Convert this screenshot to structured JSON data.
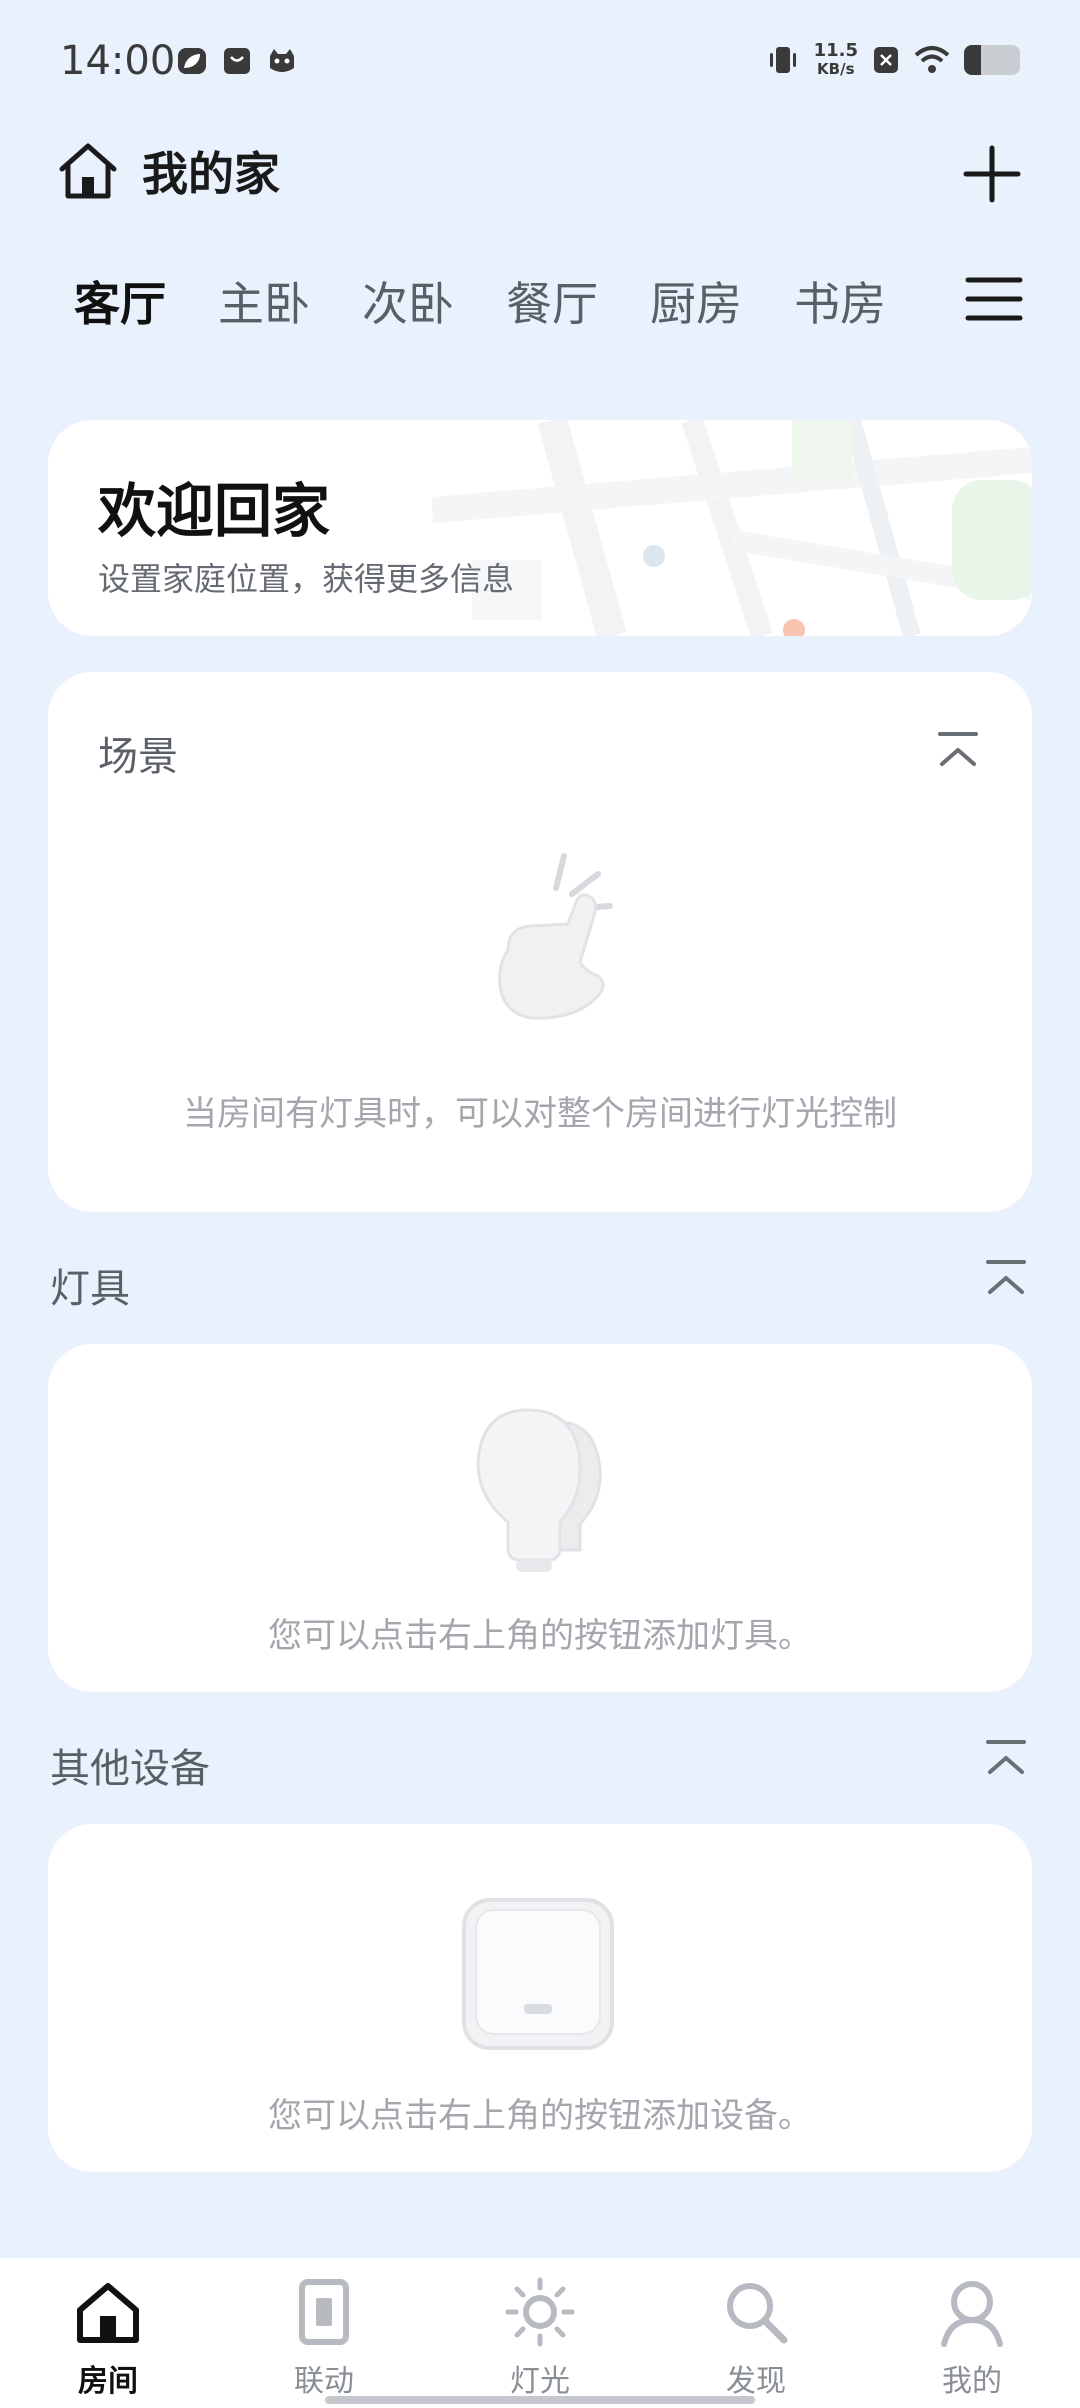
{
  "status": {
    "time": "14:00",
    "net_speed_value": "11.5",
    "net_speed_unit": "KB/s",
    "battery_level": 0.3,
    "icons": [
      "leaf-app-icon",
      "shopping-bag-icon",
      "cat-app-icon",
      "vibrate-icon",
      "close-notification-icon",
      "wifi-icon",
      "battery-icon"
    ]
  },
  "header": {
    "home_icon": "home-outline-icon",
    "title": "我的家",
    "add_icon": "plus-icon"
  },
  "rooms": {
    "tabs": [
      "客厅",
      "主卧",
      "次卧",
      "餐厅",
      "厨房",
      "书房"
    ],
    "active_index": 0,
    "menu_icon": "menu-icon"
  },
  "welcome": {
    "title": "欢迎回家",
    "subtitle": "设置家庭位置，获得更多信息"
  },
  "scene": {
    "title": "场景",
    "empty_text": "当房间有灯具时，可以对整个房间进行灯光控制"
  },
  "lights": {
    "title": "灯具",
    "empty_text": "您可以点击右上角的按钮添加灯具。"
  },
  "devices": {
    "title": "其他设备",
    "empty_text": "您可以点击右上角的按钮添加设备。"
  },
  "nav": {
    "items": [
      {
        "label": "房间",
        "icon": "home-icon"
      },
      {
        "label": "联动",
        "icon": "linkage-icon"
      },
      {
        "label": "灯光",
        "icon": "sun-icon"
      },
      {
        "label": "发现",
        "icon": "search-icon"
      },
      {
        "label": "我的",
        "icon": "profile-icon"
      }
    ],
    "active_index": 0
  },
  "colors": {
    "background": "#e8f1fc",
    "card": "#ffffff",
    "text_primary": "#111111",
    "text_secondary": "#5a5f66",
    "text_muted": "#a3a7ad"
  }
}
